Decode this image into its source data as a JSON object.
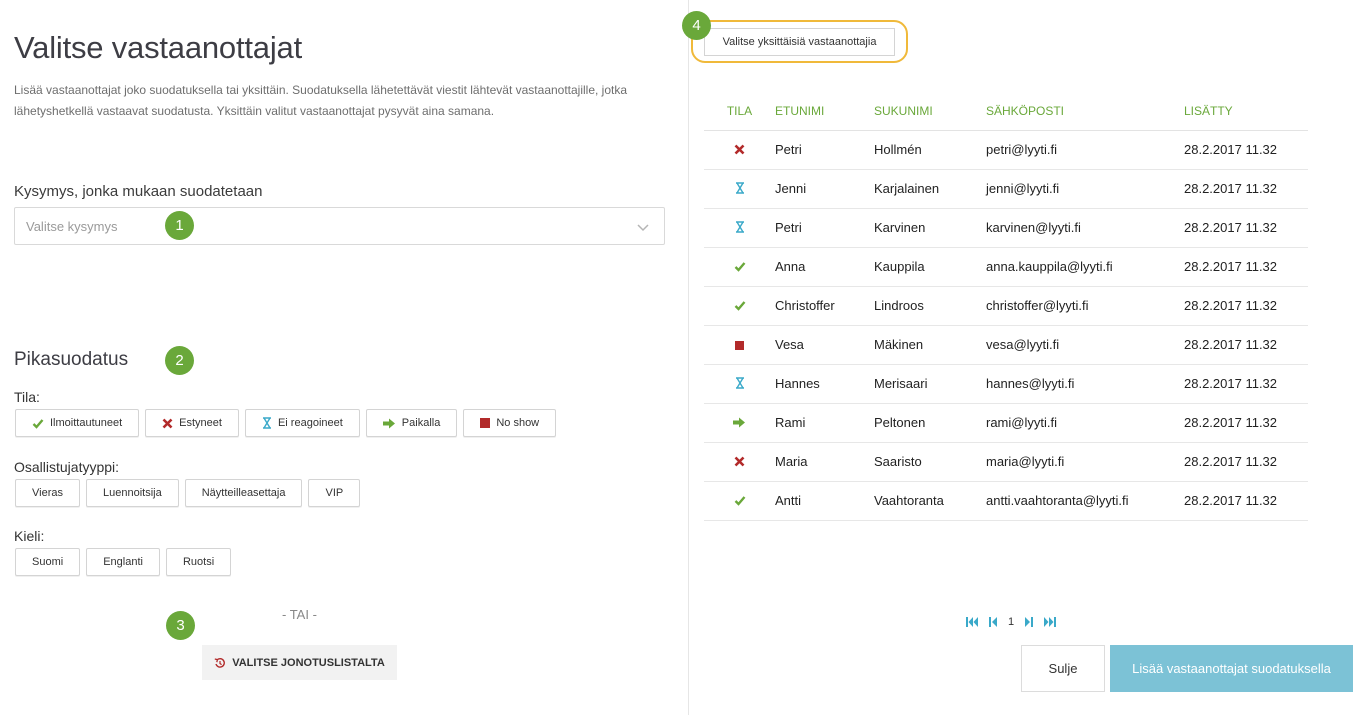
{
  "colors": {
    "accent_green": "#6aa83a",
    "highlight_yellow": "#f0b93a",
    "primary_blue": "#7cc2d6",
    "error_red": "#b22a2a",
    "wait_blue": "#3aa9c9"
  },
  "header": {
    "title": "Valitse vastaanottajat",
    "intro": "Lisää vastaanottajat joko suodatuksella tai yksittäin. Suodatuksella lähetettävät viestit lähtevät vastaanottajille, jotka lähetyshetkellä vastaavat suodatusta. Yksittäin valitut vastaanottajat pysyvät aina samana."
  },
  "question_filter": {
    "label": "Kysymys, jonka mukaan suodatetaan",
    "placeholder": "Valitse kysymys",
    "icon": "chevron-down-icon"
  },
  "badges": [
    "1",
    "2",
    "3",
    "4"
  ],
  "quick_filter": {
    "title": "Pikasuodatus",
    "status_label": "Tila:",
    "status_buttons": [
      {
        "label": "Ilmoittautuneet",
        "icon": "check-icon"
      },
      {
        "label": "Estyneet",
        "icon": "cross-icon"
      },
      {
        "label": "Ei reagoineet",
        "icon": "hourglass-icon"
      },
      {
        "label": "Paikalla",
        "icon": "arrow-right-icon"
      },
      {
        "label": "No show",
        "icon": "square-icon"
      }
    ],
    "type_label": "Osallistujatyyppi:",
    "type_buttons": [
      "Vieras",
      "Luennoitsija",
      "Näytteilleasettaja",
      "VIP"
    ],
    "language_label": "Kieli:",
    "language_buttons": [
      "Suomi",
      "Englanti",
      "Ruotsi"
    ]
  },
  "or_text": "- TAI -",
  "queue_button": {
    "label": "VALITSE JONOTUSLISTALTA",
    "icon": "history-icon"
  },
  "individual_button": "Valitse yksittäisiä vastaanottajia",
  "table": {
    "columns": [
      "TILA",
      "ETUNIMI",
      "SUKUNIMI",
      "SÄHKÖPOSTI",
      "LISÄTTY"
    ],
    "rows": [
      {
        "status": "cross-icon",
        "first": "Petri",
        "last": "Hollmén",
        "email": "petri@lyyti.fi",
        "added": "28.2.2017 11.32"
      },
      {
        "status": "hourglass-icon",
        "first": "Jenni",
        "last": "Karjalainen",
        "email": "jenni@lyyti.fi",
        "added": "28.2.2017 11.32"
      },
      {
        "status": "hourglass-icon",
        "first": "Petri",
        "last": "Karvinen",
        "email": "karvinen@lyyti.fi",
        "added": "28.2.2017 11.32"
      },
      {
        "status": "check-icon",
        "first": "Anna",
        "last": "Kauppila",
        "email": "anna.kauppila@lyyti.fi",
        "added": "28.2.2017 11.32"
      },
      {
        "status": "check-icon",
        "first": "Christoffer",
        "last": "Lindroos",
        "email": "christoffer@lyyti.fi",
        "added": "28.2.2017 11.32"
      },
      {
        "status": "square-icon",
        "first": "Vesa",
        "last": "Mäkinen",
        "email": "vesa@lyyti.fi",
        "added": "28.2.2017 11.32"
      },
      {
        "status": "hourglass-icon",
        "first": "Hannes",
        "last": "Merisaari",
        "email": "hannes@lyyti.fi",
        "added": "28.2.2017 11.32"
      },
      {
        "status": "arrow-right-icon",
        "first": "Rami",
        "last": "Peltonen",
        "email": "rami@lyyti.fi",
        "added": "28.2.2017 11.32"
      },
      {
        "status": "cross-icon",
        "first": "Maria",
        "last": "Saaristo",
        "email": "maria@lyyti.fi",
        "added": "28.2.2017 11.32"
      },
      {
        "status": "check-icon",
        "first": "Antti",
        "last": "Vaahtoranta",
        "email": "antti.vaahtoranta@lyyti.fi",
        "added": "28.2.2017 11.32"
      }
    ]
  },
  "pagination": {
    "current_page": "1"
  },
  "footer": {
    "close_label": "Sulje",
    "add_label": "Lisää vastaanottajat suodatuksella"
  }
}
